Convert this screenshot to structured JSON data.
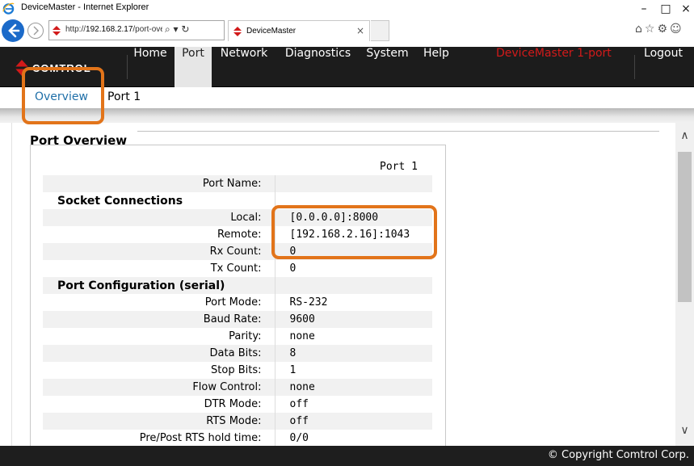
{
  "browser": {
    "window_title": "DeviceMaster - Internet Explorer",
    "url_prefix": "http://",
    "url_host": "192.168.2.17",
    "url_path": "/port-overviе",
    "address_icons": "⌕ ▾ ↻",
    "tab_label": "DeviceMaster",
    "tab_close": "×",
    "minimize": "–",
    "maximize": "□",
    "close": "×",
    "tool_icons": "⌂☆⚙☺"
  },
  "header": {
    "logo_text": "COMTROL",
    "nav": [
      "Home",
      "Port",
      "Network",
      "Diagnostics",
      "System",
      "Help"
    ],
    "active_nav": "Port",
    "device_name": "DeviceMaster 1-port",
    "logout": "Logout"
  },
  "subnav": {
    "items": [
      "Overview",
      "Port 1"
    ]
  },
  "page": {
    "title": "Port Overview",
    "column_header": "Port 1",
    "rows": [
      {
        "label": "Port Name:",
        "value": ""
      },
      {
        "section": "Socket Connections"
      },
      {
        "label": "Local:",
        "value": "[0.0.0.0]:8000"
      },
      {
        "label": "Remote:",
        "value": "[192.168.2.16]:1043"
      },
      {
        "label": "Rx Count:",
        "value": "0"
      },
      {
        "label": "Tx Count:",
        "value": "0"
      },
      {
        "section": "Port Configuration (serial)"
      },
      {
        "label": "Port Mode:",
        "value": "RS-232"
      },
      {
        "label": "Baud Rate:",
        "value": "9600"
      },
      {
        "label": "Parity:",
        "value": "none"
      },
      {
        "label": "Data Bits:",
        "value": "8"
      },
      {
        "label": "Stop Bits:",
        "value": "1"
      },
      {
        "label": "Flow Control:",
        "value": "none"
      },
      {
        "label": "DTR Mode:",
        "value": "off"
      },
      {
        "label": "RTS Mode:",
        "value": "off"
      },
      {
        "label": "Pre/Post RTS hold time:",
        "value": "0/0"
      }
    ]
  },
  "scrollbar": {
    "up": "∧",
    "down": "∨"
  },
  "footer": {
    "copyright": "© Copyright Comtrol Corp."
  },
  "colors": {
    "header_bg": "#1c1c1c",
    "device_name": "#d21a1a",
    "link": "#1f6fa8",
    "highlight": "#e2741a"
  }
}
